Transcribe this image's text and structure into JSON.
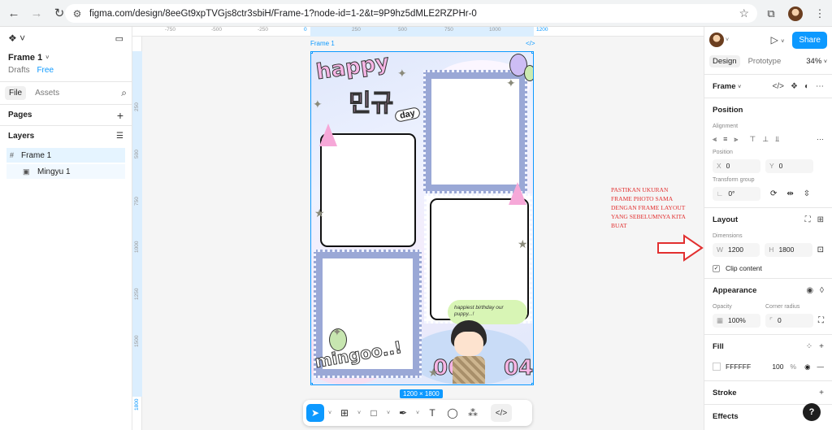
{
  "browser": {
    "url": "figma.com/design/8eeGt9xpTVGjs8ctr3sbiH/Frame-1?node-id=1-2&t=9P9hz5dMLE2RZPHr-0"
  },
  "left": {
    "file_title": "Frame 1",
    "drafts": "Drafts",
    "plan": "Free",
    "tabs": [
      "File",
      "Assets"
    ],
    "pages_label": "Pages",
    "layers_label": "Layers",
    "layers": [
      {
        "name": "Frame 1",
        "selected": true,
        "icon": "frame-icon"
      },
      {
        "name": "Mingyu 1",
        "selected": false,
        "icon": "image-icon"
      }
    ]
  },
  "canvas": {
    "frame_label": "Frame 1",
    "frame_code": "</>",
    "ruler_top": [
      "-750",
      "-500",
      "-250",
      "0",
      "250",
      "500",
      "750",
      "1000",
      "1200"
    ],
    "ruler_left": [
      "250",
      "500",
      "750",
      "1000",
      "1250",
      "1500",
      "1800"
    ],
    "size_badge": "1200 × 1800",
    "art": {
      "happy": "happy",
      "name": "민규",
      "day": "day",
      "mingoo": "mingoo..!",
      "num_left": "06",
      "num_right": "04",
      "bubble": "happiest birthday our puppy...!"
    }
  },
  "annotation": {
    "lines": [
      "PASTIKAN UKURAN",
      "FRAME PHOTO SAMA",
      "DENGAN FRAME LAYOUT",
      "YANG SEBELUMNYA KITA",
      "BUAT"
    ],
    "color": "#e23030"
  },
  "toolbar": {
    "tools": [
      "move-tool",
      "frame-tool",
      "shape-tool",
      "pen-tool",
      "text-tool",
      "comment-tool",
      "actions-tool",
      "dev-mode-toggle"
    ]
  },
  "right": {
    "share": "Share",
    "tabs": [
      "Design",
      "Prototype"
    ],
    "zoom": "34%",
    "frame_type": "Frame",
    "position_h": "Position",
    "alignment_lbl": "Alignment",
    "position_lbl": "Position",
    "x": "0",
    "y": "0",
    "transform_lbl": "Transform group",
    "rotation": "0°",
    "layout_h": "Layout",
    "dimensions_lbl": "Dimensions",
    "w": "1200",
    "h": "1800",
    "clip": "Clip content",
    "appearance_h": "Appearance",
    "opacity_lbl": "Opacity",
    "radius_lbl": "Corner radius",
    "opacity": "100%",
    "radius": "0",
    "fill_h": "Fill",
    "fill_hex": "FFFFFF",
    "fill_opacity": "100",
    "fill_pct": "%",
    "stroke_h": "Stroke",
    "effects_h": "Effects",
    "help": "?"
  }
}
